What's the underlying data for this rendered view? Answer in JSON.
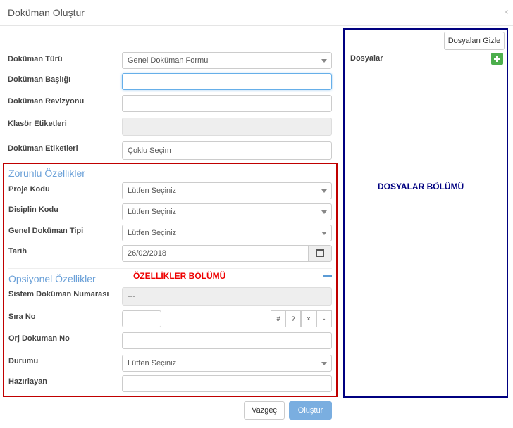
{
  "modal": {
    "title": "Doküman Oluştur",
    "close_glyph": "×"
  },
  "general": {
    "doc_type": {
      "label": "Doküman Türü",
      "value": "Genel Doküman Formu"
    },
    "doc_title": {
      "label": "Doküman Başlığı",
      "value": ""
    },
    "doc_revision": {
      "label": "Doküman Revizyonu",
      "value": ""
    },
    "folder_tags": {
      "label": "Klasör Etiketleri",
      "value": ""
    },
    "doc_tags": {
      "label": "Doküman Etiketleri",
      "placeholder": "Çoklu Seçim"
    }
  },
  "required": {
    "heading": "Zorunlu Özellikler",
    "project_code": {
      "label": "Proje Kodu",
      "value": "Lütfen Seçiniz"
    },
    "discipline_code": {
      "label": "Disiplin Kodu",
      "value": "Lütfen Seçiniz"
    },
    "general_doc_type": {
      "label": "Genel Doküman Tipi",
      "value": "Lütfen Seçiniz"
    },
    "date": {
      "label": "Tarih",
      "value": "26/02/2018",
      "icon": "calendar-icon"
    }
  },
  "optional": {
    "heading": "Opsiyonel Özellikler",
    "collapse_icon": "minus-icon",
    "system_doc_no": {
      "label": "Sistem Doküman Numarası",
      "value": "---"
    },
    "seq_no": {
      "label": "Sıra No",
      "value": "",
      "buttons": [
        "#",
        "?",
        "×",
        "-"
      ]
    },
    "orig_doc_no": {
      "label": "Orj Dokuman No",
      "value": ""
    },
    "status": {
      "label": "Durumu",
      "value": "Lütfen Seçiniz"
    },
    "prepared_by": {
      "label": "Hazırlayan",
      "value": ""
    }
  },
  "annotations": {
    "properties": "ÖZELLİKLER BÖLÜMÜ",
    "files": "DOSYALAR BÖLÜMÜ"
  },
  "files_panel": {
    "hide_button": "Dosyaları Gizle",
    "label": "Dosyalar",
    "add_icon": "plus-icon"
  },
  "footer": {
    "cancel": "Vazgeç",
    "create": "Oluştur"
  },
  "colors": {
    "annotation_red": "#e00000",
    "annotation_blue": "#000080",
    "primary_button": "#7aaee0",
    "add_button": "#4cae4c"
  }
}
